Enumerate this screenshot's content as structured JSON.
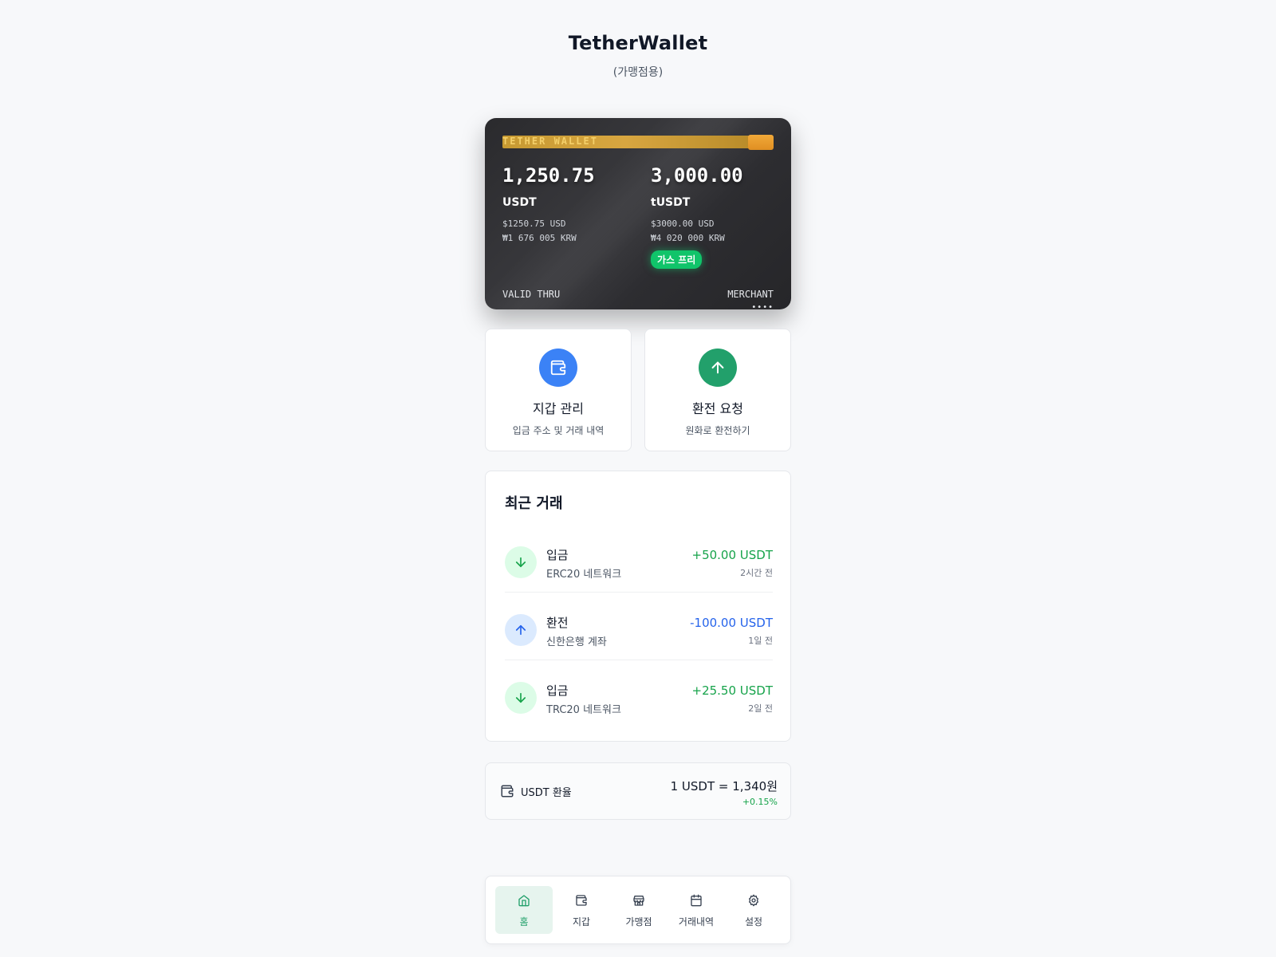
{
  "header": {
    "title": "TetherWallet",
    "subtitle": "(가맹점용)"
  },
  "card": {
    "brand": "TETHER WALLET",
    "balances": [
      {
        "amount": "1,250.75",
        "currency": "USDT",
        "usd": "$1250.75 USD",
        "krw": "₩1 676 005 KRW"
      },
      {
        "amount": "3,000.00",
        "currency": "tUSDT",
        "usd": "$3000.00 USD",
        "krw": "₩4 020 000 KRW",
        "badge": "가스 프리"
      }
    ],
    "valid_thru": "VALID THRU",
    "merchant": "MERCHANT",
    "merchant_sub": "••••",
    "colors": {
      "gold": "#d8a640",
      "badge": "#10c46a"
    }
  },
  "actions": [
    {
      "title": "지갑 관리",
      "desc": "입금 주소 및 거래 내역",
      "icon": "wallet-icon",
      "color": "#3b82f6"
    },
    {
      "title": "환전 요청",
      "desc": "원화로 환전하기",
      "icon": "arrow-up-icon",
      "color": "#22a06b"
    }
  ],
  "recent": {
    "title": "최근 거래",
    "items": [
      {
        "type": "입금",
        "network": "ERC20 네트워크",
        "amount": "+50.00 USDT",
        "time": "2시간 전",
        "direction": "in"
      },
      {
        "type": "환전",
        "network": "신한은행 계좌",
        "amount": "-100.00 USDT",
        "time": "1일 전",
        "direction": "out"
      },
      {
        "type": "입금",
        "network": "TRC20 네트워크",
        "amount": "+25.50 USDT",
        "time": "2일 전",
        "direction": "in"
      }
    ]
  },
  "rate": {
    "label": "USDT 환율",
    "value": "1 USDT = 1,340원",
    "change": "+0.15%"
  },
  "nav": {
    "items": [
      {
        "label": "홈",
        "icon": "home-icon",
        "active": true
      },
      {
        "label": "지갑",
        "icon": "wallet-icon"
      },
      {
        "label": "가맹점",
        "icon": "store-icon"
      },
      {
        "label": "거래내역",
        "icon": "calendar-icon"
      },
      {
        "label": "설정",
        "icon": "gear-icon"
      }
    ]
  },
  "colors": {
    "accent_green": "#22a06b",
    "accent_blue": "#3b82f6",
    "positive": "#16a34a",
    "negative": "#2563eb"
  }
}
